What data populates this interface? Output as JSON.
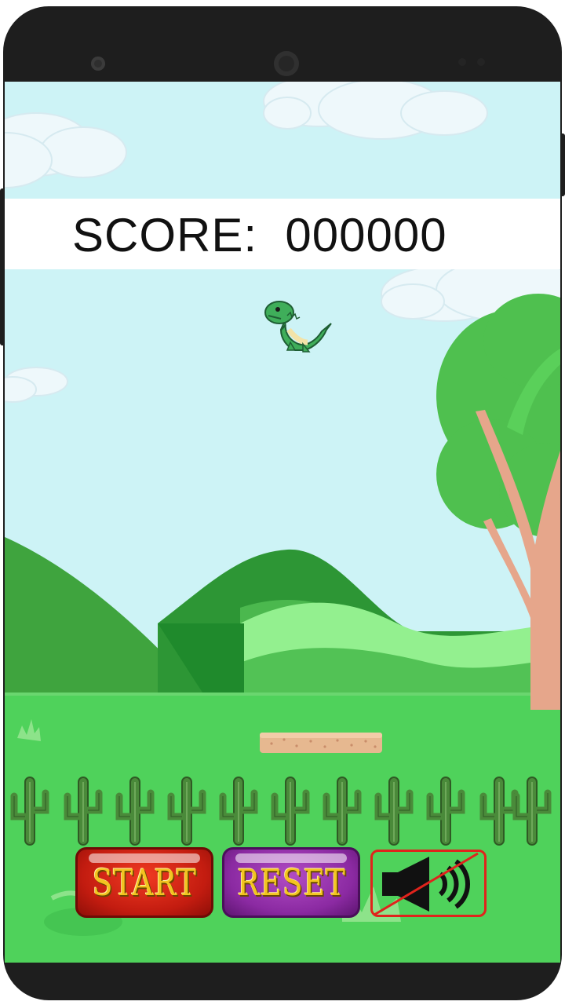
{
  "hud": {
    "score_label": "SCORE:  000000"
  },
  "controls": {
    "start_label": "START",
    "reset_label": "RESET",
    "sound_icon": "speaker-muted-icon"
  },
  "colors": {
    "sky": "#cdf3f6",
    "grass": "#4fd25b",
    "start_button": "#d32414",
    "reset_button": "#9a33b0",
    "button_text": "#f3c420",
    "mute_slash": "#e0231c"
  }
}
